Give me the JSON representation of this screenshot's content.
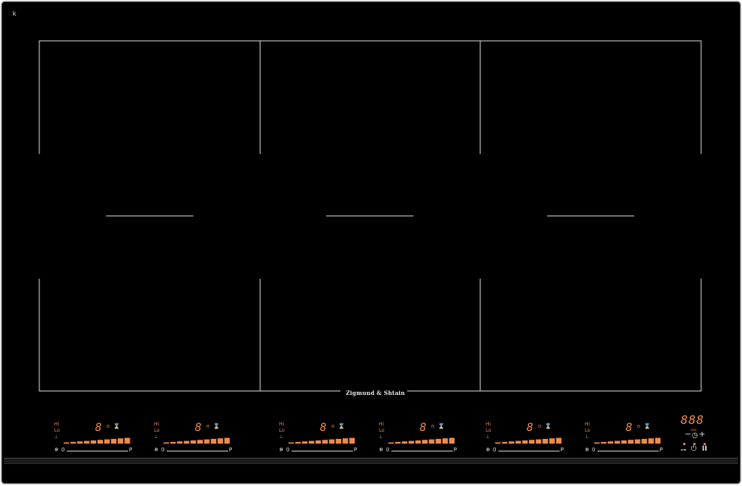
{
  "cooktop": {
    "brand": "Zigmund & Shtain",
    "cursor_glyph": "k"
  },
  "zones": [
    {
      "id": "zone-1"
    },
    {
      "id": "zone-2"
    },
    {
      "id": "zone-3"
    }
  ],
  "controls": [
    {
      "levels": [
        "Hi",
        "Lo",
        "⊥"
      ],
      "display": "8",
      "mini_a": "∩",
      "mini_b": "⌛",
      "zero": "0",
      "p": "P",
      "snow": "❄"
    },
    {
      "levels": [
        "Hi",
        "Lo",
        "⊥"
      ],
      "display": "8",
      "mini_a": "∩",
      "mini_b": "⌛",
      "zero": "0",
      "p": "P",
      "snow": "❄"
    },
    {
      "levels": [
        "Hi",
        "Lo",
        "⊥"
      ],
      "display": "8",
      "mini_a": "∩",
      "mini_b": "⌛",
      "zero": "0",
      "p": "P",
      "snow": "❄"
    },
    {
      "levels": [
        "Hi",
        "Lo",
        "⊥"
      ],
      "display": "8",
      "mini_a": "∩",
      "mini_b": "⌛",
      "zero": "0",
      "p": "P",
      "snow": "❄"
    },
    {
      "levels": [
        "Hi",
        "Lo",
        "⊥"
      ],
      "display": "8",
      "mini_a": "∩",
      "mini_b": "⌛",
      "zero": "0",
      "p": "P",
      "snow": "❄"
    },
    {
      "levels": [
        "Hi",
        "Lo",
        "⊥"
      ],
      "display": "8",
      "mini_a": "∩",
      "mini_b": "⌛",
      "zero": "0",
      "p": "P",
      "snow": "❄"
    }
  ],
  "timer": {
    "digits": "888",
    "unit": "min",
    "minus": "−",
    "clock": "◷",
    "plus": "+",
    "key": "⊶",
    "power": "⏻",
    "pause": "II"
  },
  "colors": {
    "accent": "#f08a4a",
    "line": "#d8d8d8",
    "surface": "#000000"
  },
  "icons": {
    "cursor": "cursor-icon",
    "timer_clock": "clock-icon",
    "lock": "key-icon",
    "power": "power-icon",
    "pause": "pause-icon"
  }
}
